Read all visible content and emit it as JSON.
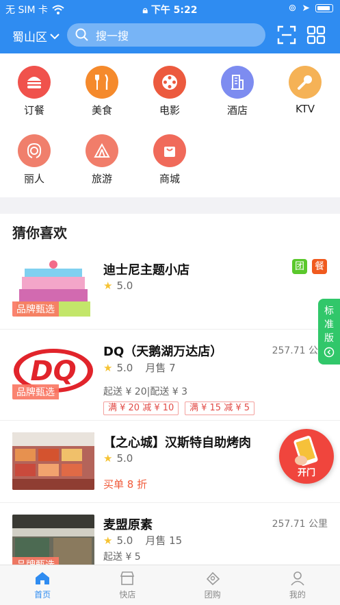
{
  "status": {
    "carrier": "无 SIM 卡",
    "time": "下午 5:22"
  },
  "header": {
    "city": "蜀山区",
    "search_placeholder": "搜一搜"
  },
  "categories": [
    {
      "label": "订餐",
      "color": "#f0524c"
    },
    {
      "label": "美食",
      "color": "#f58a2c"
    },
    {
      "label": "电影",
      "color": "#ec5a3e"
    },
    {
      "label": "酒店",
      "color": "#7d8cf0"
    },
    {
      "label": "KTV",
      "color": "#f5b256"
    },
    {
      "label": "丽人",
      "color": "#f07f6c"
    },
    {
      "label": "旅游",
      "color": "#f17d6a"
    },
    {
      "label": "商城",
      "color": "#f06a5a"
    }
  ],
  "section_title": "猜你喜欢",
  "items": [
    {
      "name": "迪士尼主题小店",
      "rating": "5.0",
      "brand_tag": "品牌甄选",
      "badges": [
        "团",
        "餐"
      ]
    },
    {
      "name": "DQ（天鹅湖万达店）",
      "rating": "5.0",
      "sold": "月售 7",
      "distance": "257.71 公里",
      "delivery": "起送 ¥ 20|配送 ¥ 3",
      "promos": [
        "满 ¥ 20 减 ¥ 10",
        "满 ¥ 15 减 ¥ 5"
      ],
      "brand_tag": "品牌甄选"
    },
    {
      "name": "【之心城】汉斯特自助烤肉",
      "rating": "5.0",
      "discount": "买单 8 折"
    },
    {
      "name": "麦盟原素",
      "rating": "5.0",
      "sold": "月售 15",
      "distance": "257.71 公里",
      "delivery": "起送 ¥ 5",
      "brand_tag": "品牌甄选"
    }
  ],
  "float_std": "标准版",
  "float_door": "开门",
  "tabs": [
    {
      "label": "首页"
    },
    {
      "label": "快店"
    },
    {
      "label": "团购"
    },
    {
      "label": "我的"
    }
  ]
}
